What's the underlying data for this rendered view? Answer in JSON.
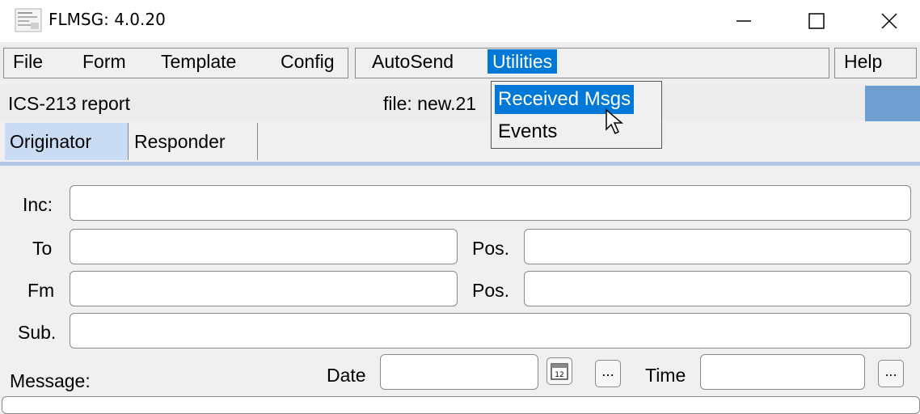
{
  "window": {
    "title": "FLMSG: 4.0.20",
    "minimize_glyph": "—",
    "maximize_glyph": "☐",
    "close_glyph": "✕"
  },
  "menubar": {
    "file": "File",
    "form": "Form",
    "template": "Template",
    "config": "Config",
    "autosend": "AutoSend",
    "utilities": "Utilities",
    "help": "Help"
  },
  "infobar": {
    "form_name": "ICS-213 report",
    "file_label": "file: new.21"
  },
  "dropdown": {
    "items": [
      "Received Msgs",
      "Events"
    ],
    "highlighted": "Received Msgs"
  },
  "tabs": {
    "originator": "Originator",
    "responder": "Responder",
    "active": "Originator"
  },
  "form": {
    "inc_label": "Inc:",
    "to_label": "To",
    "fm_label": "Fm",
    "pos_label_1": "Pos.",
    "pos_label_2": "Pos.",
    "sub_label": "Sub.",
    "date_label": "Date",
    "time_label": "Time",
    "message_label": "Message:",
    "calendar_glyph": "12",
    "ellipsis_1": "...",
    "ellipsis_2": "...",
    "inc_value": "",
    "to_value": "",
    "fm_value": "",
    "pos1_value": "",
    "pos2_value": "",
    "sub_value": "",
    "date_value": "",
    "time_value": ""
  },
  "colors": {
    "accent": "#0078d7",
    "tab_active": "#c9dcf3",
    "blue_rect": "#6f9fd0"
  },
  "icons": [
    "app-icon",
    "calendar-icon",
    "pointer-cursor-icon"
  ]
}
